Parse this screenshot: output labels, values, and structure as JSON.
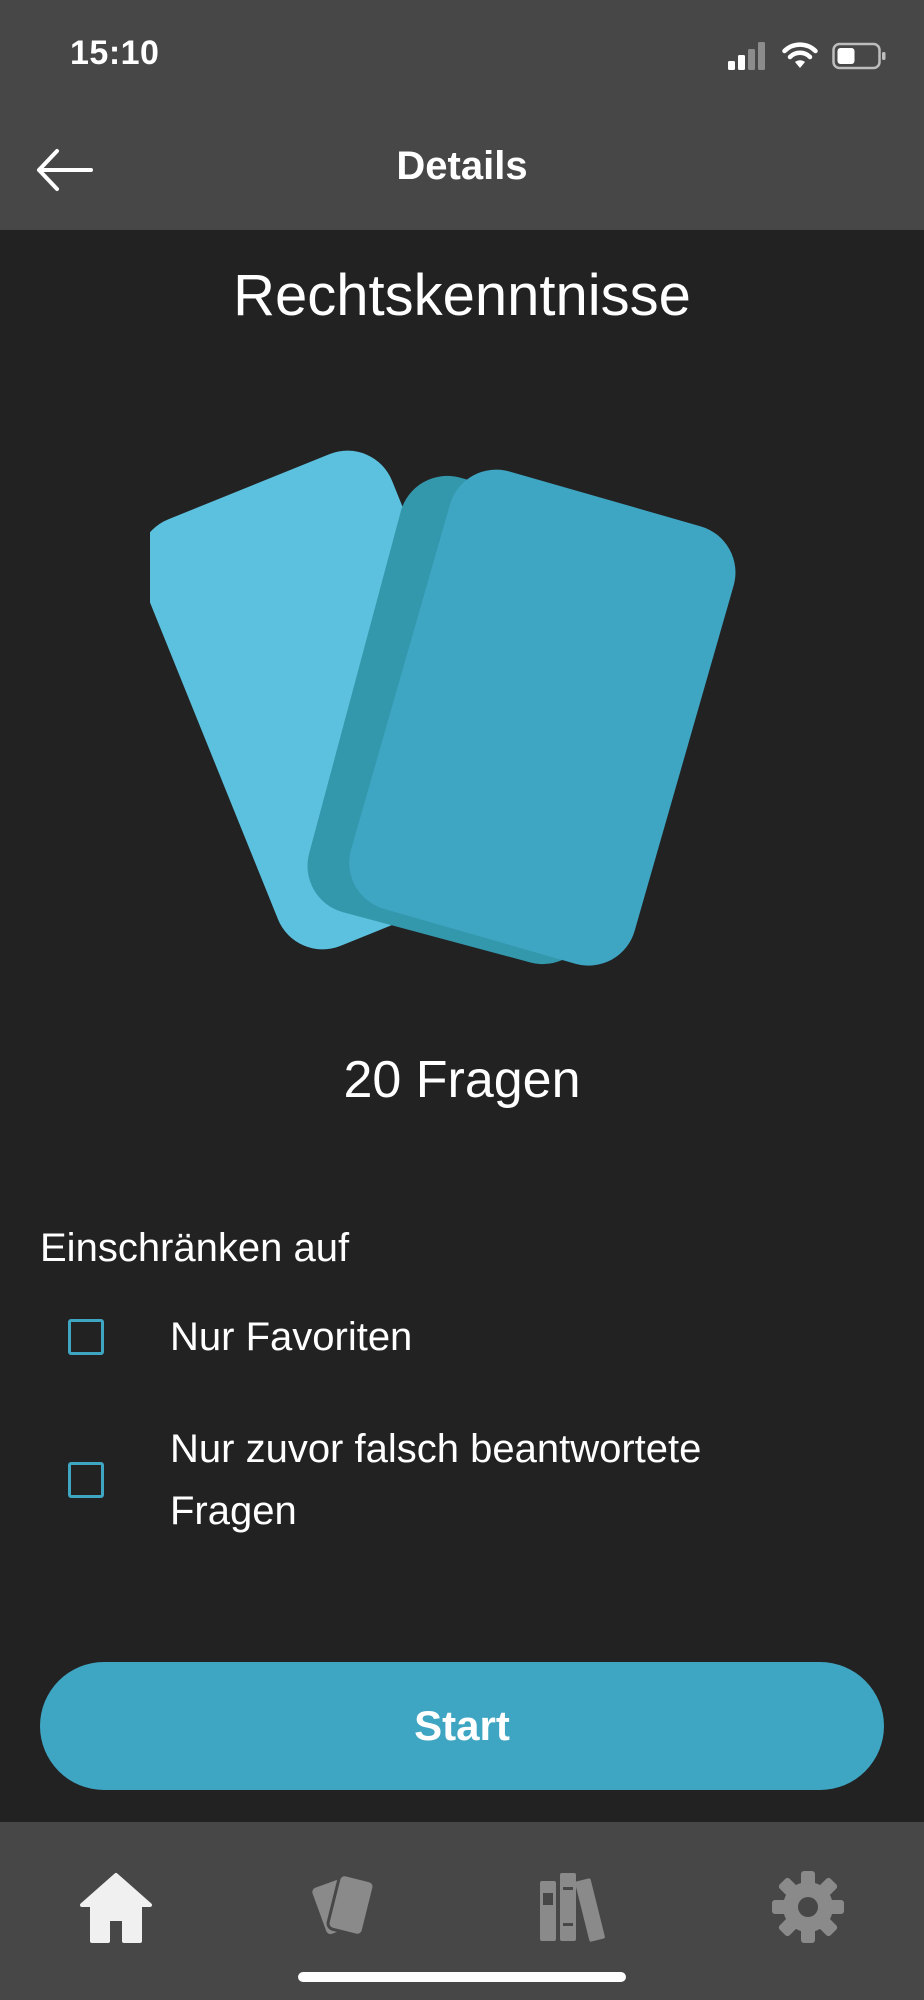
{
  "status_bar": {
    "time": "15:10",
    "icons": [
      "signal-icon",
      "wifi-icon",
      "battery-icon"
    ]
  },
  "nav": {
    "back_icon": "arrow-left-icon",
    "title": "Details"
  },
  "deck": {
    "title": "Rechtskenntnisse",
    "illustration": "cards-icon",
    "question_count_label": "20 Fragen"
  },
  "filter": {
    "heading": "Einschränken auf",
    "options": [
      {
        "label": "Nur Favoriten",
        "checked": false
      },
      {
        "label": "Nur zuvor falsch beantwortete Fragen",
        "checked": false
      }
    ]
  },
  "start_button": {
    "label": "Start"
  },
  "tab_bar": {
    "tabs": [
      {
        "icon": "home-icon",
        "active": true
      },
      {
        "icon": "cards-icon",
        "active": false
      },
      {
        "icon": "library-icon",
        "active": false
      },
      {
        "icon": "gear-icon",
        "active": false
      }
    ]
  },
  "colors": {
    "background": "#222222",
    "bars": "#474747",
    "accent": "#3ea5c3",
    "card_light": "#5bc1de",
    "active_tab_icon": "#f0f0f0",
    "inactive_tab_icon": "#8a8a8a"
  }
}
